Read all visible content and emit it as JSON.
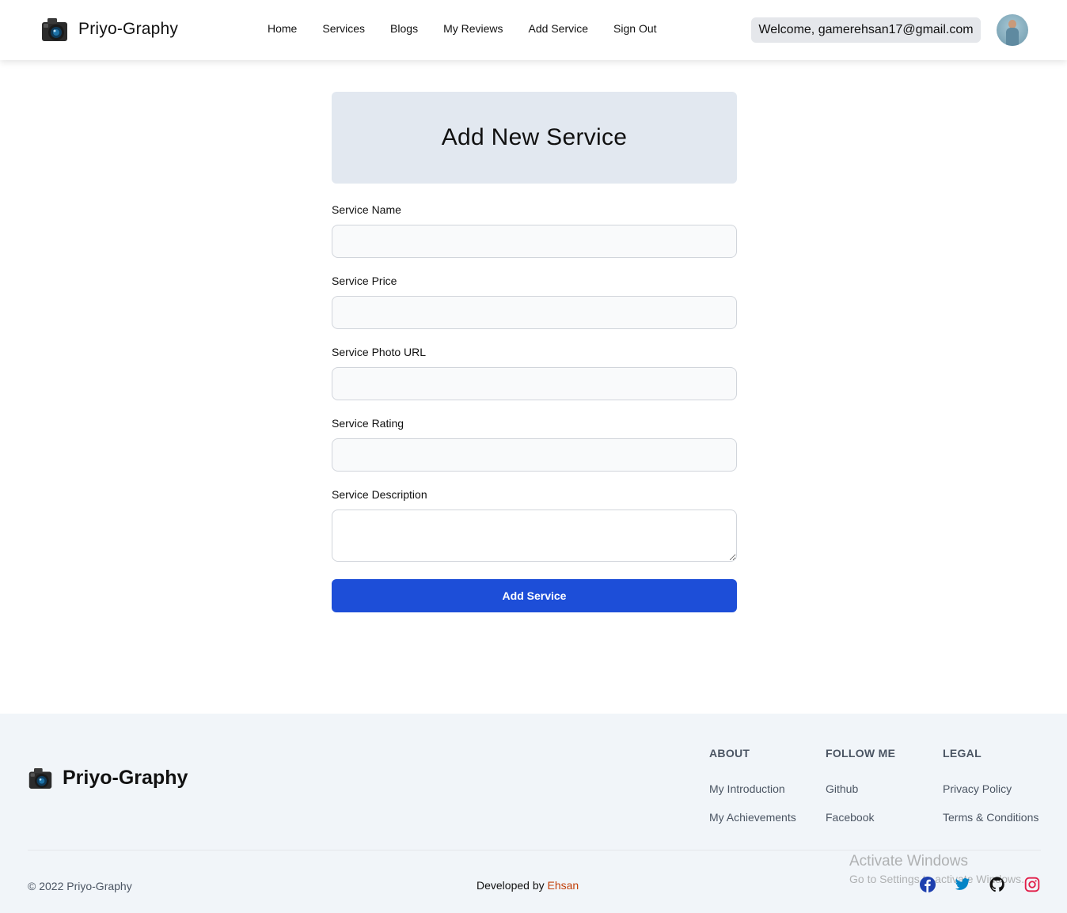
{
  "navbar": {
    "brand": "Priyo-Graphy",
    "links": [
      "Home",
      "Services",
      "Blogs",
      "My Reviews",
      "Add Service",
      "Sign Out"
    ],
    "welcome": "Welcome, gamerehsan17@gmail.com"
  },
  "form": {
    "title": "Add New Service",
    "fields": [
      {
        "label": "Service Name",
        "value": ""
      },
      {
        "label": "Service Price",
        "value": ""
      },
      {
        "label": "Service Photo URL",
        "value": ""
      },
      {
        "label": "Service Rating",
        "value": ""
      },
      {
        "label": "Service Description",
        "value": ""
      }
    ],
    "submit_label": "Add Service"
  },
  "footer": {
    "brand": "Priyo-Graphy",
    "columns": [
      {
        "heading": "ABOUT",
        "links": [
          "My Introduction",
          "My Achievements"
        ]
      },
      {
        "heading": "FOLLOW ME",
        "links": [
          "Github",
          "Facebook"
        ]
      },
      {
        "heading": "LEGAL",
        "links": [
          "Privacy Policy",
          "Terms & Conditions"
        ]
      }
    ],
    "copyright": "© 2022 Priyo-Graphy",
    "developed_by": "Developed by",
    "developer": "Ehsan",
    "socials": [
      "facebook-icon",
      "twitter-icon",
      "github-icon",
      "instagram-icon"
    ]
  },
  "watermark": {
    "line1": "Activate Windows",
    "line2": "Go to Settings to activate Windows."
  },
  "colors": {
    "primary_button": "#1d4ed8",
    "hero_bg": "#e2e8f0",
    "footer_bg": "#f1f5f9",
    "developer_link": "#c2410c"
  }
}
